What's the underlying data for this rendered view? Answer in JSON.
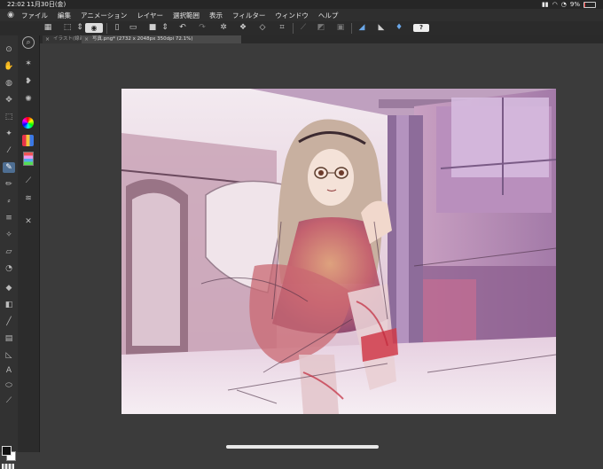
{
  "status_bar": {
    "time": "22:02",
    "date": "11月30日(金)",
    "battery": "9%",
    "battery_fraction": 0.09
  },
  "menu": {
    "items": [
      "ファイル",
      "編集",
      "アニメーション",
      "レイヤー",
      "選択範囲",
      "表示",
      "フィルター",
      "ウィンドウ",
      "ヘルプ"
    ]
  },
  "command_bar": {
    "help_label": "?"
  },
  "tabs": [
    {
      "label": "イラスト(線画)",
      "active": false
    },
    {
      "label": "写真.png* (2732 x 2048px 350dpi 72.1%)",
      "active": true
    }
  ],
  "icons": {
    "logo": "clip-studio-logo",
    "eye": "eye-icon",
    "wifi": "wifi-icon",
    "battery": "battery-icon"
  },
  "colors": {
    "accent": "#4e6e92",
    "foreground": "#111111",
    "background": "#ffffff",
    "workspace": "#3b3b3b"
  }
}
